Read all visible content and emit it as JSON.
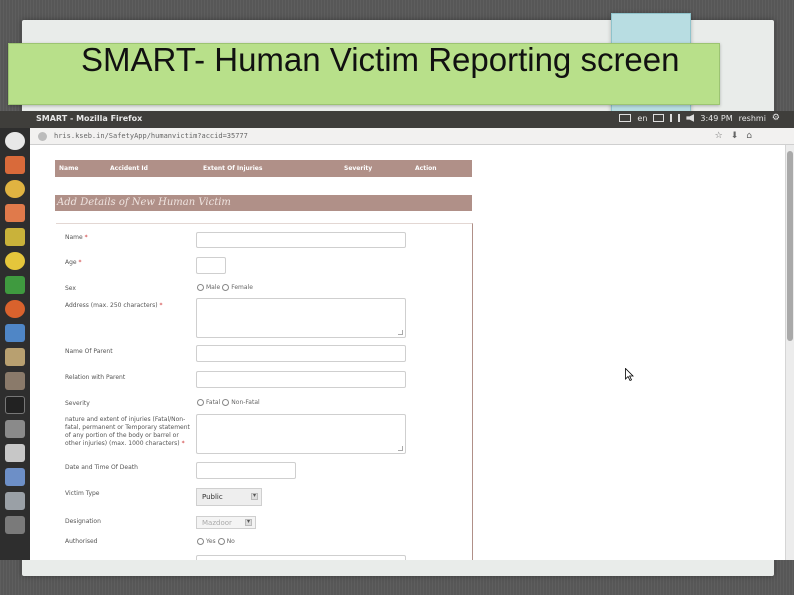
{
  "slide": {
    "title": "SMART- Human Victim Reporting screen",
    "accent_color": "#b8e08a"
  },
  "system_panel": {
    "window_title": "SMART - Mozilla Firefox",
    "keyboard_layout": "en",
    "time": "3:49 PM",
    "user": "reshmi"
  },
  "browser": {
    "url": "hris.kseb.in/SafetyApp/humanvictim?accid=35777"
  },
  "table": {
    "header_color": "#b09088",
    "columns": [
      "Name",
      "Accident Id",
      "Extent Of Injuries",
      "Severity",
      "Action"
    ]
  },
  "form": {
    "section_title": "Add Details of New Human Victim",
    "name_label": "Name",
    "age_label": "Age",
    "sex_label": "Sex",
    "sex_options": [
      "Male",
      "Female"
    ],
    "address_label": "Address (max. 250 characters)",
    "parent_label": "Name Of Parent",
    "relation_label": "Relation with Parent",
    "severity_label": "Severity",
    "severity_options": [
      "Fatal",
      "Non-Fatal"
    ],
    "injuries_label": "nature and extent of injuries (Fatal/Non-fatal, permanent or Temporary statement of any portion of the body or barrel or other injuries) (max. 1000 characters)",
    "death_label": "Date and Time Of Death",
    "victim_type_label": "Victim Type",
    "victim_type_value": "Public",
    "designation_label": "Designation",
    "designation_value": "Mazdoor",
    "authorised_label": "Authorised",
    "authorised_options": [
      "Yes",
      "No"
    ]
  }
}
